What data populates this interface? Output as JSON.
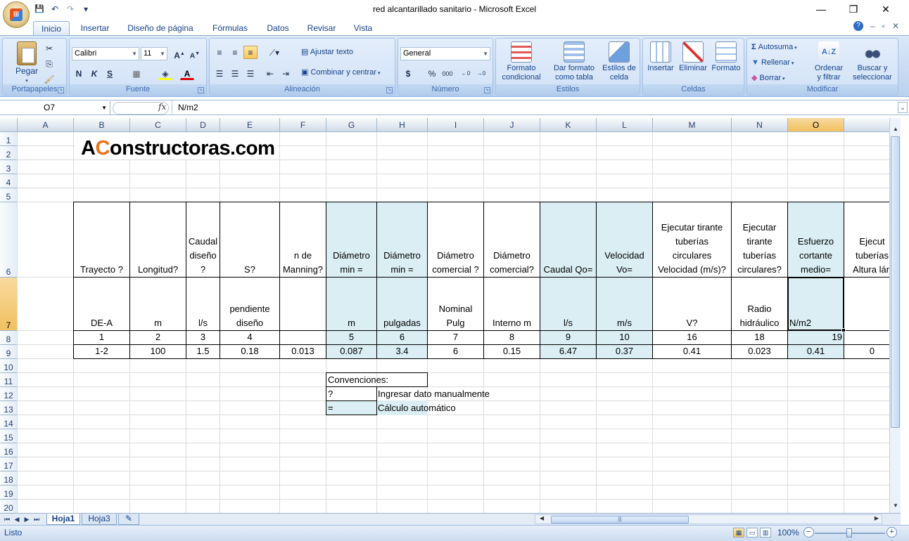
{
  "window": {
    "title": "red alcantarillado sanitario - Microsoft Excel",
    "minimize": "—",
    "restore": "❐",
    "close": "✕"
  },
  "qat": {
    "save": "💾",
    "undo": "↶",
    "redo": "↷",
    "customize": "▾"
  },
  "tabs": [
    "Inicio",
    "Insertar",
    "Diseño de página",
    "Fórmulas",
    "Datos",
    "Revisar",
    "Vista"
  ],
  "ribbon": {
    "portapapeles": {
      "label": "Portapapeles",
      "pegar": "Pegar"
    },
    "fuente": {
      "label": "Fuente",
      "font": "Calibri",
      "size": "11",
      "bold": "N",
      "italic": "K",
      "underline": "S"
    },
    "alineacion": {
      "label": "Alineación",
      "ajustar": "Ajustar texto",
      "combinar": "Combinar y centrar"
    },
    "numero": {
      "label": "Número",
      "format": "General",
      "currency": "$",
      "percent": "%",
      "thousands": "000"
    },
    "estilos": {
      "label": "Estilos",
      "formato_condicional": [
        "Formato",
        "condicional"
      ],
      "dar_formato": [
        "Dar formato",
        "como tabla"
      ],
      "estilos_celda": [
        "Estilos de",
        "celda"
      ]
    },
    "celdas": {
      "label": "Celdas",
      "insertar": "Insertar",
      "eliminar": "Eliminar",
      "formato": "Formato"
    },
    "modificar": {
      "label": "Modificar",
      "autosuma": "Autosuma",
      "rellenar": "Rellenar",
      "borrar": "Borrar",
      "ordenar": [
        "Ordenar",
        "y filtrar"
      ],
      "buscar": [
        "Buscar y",
        "seleccionar"
      ]
    }
  },
  "formula_bar": {
    "name_box": "O7",
    "fx": "fx",
    "formula": "N/m2"
  },
  "columns": [
    "A",
    "B",
    "C",
    "D",
    "E",
    "F",
    "G",
    "H",
    "I",
    "J",
    "K",
    "L",
    "M",
    "N",
    "O"
  ],
  "rows": [
    "1",
    "2",
    "3",
    "4",
    "5",
    "6",
    "7",
    "8",
    "9",
    "10",
    "11",
    "12",
    "13",
    "14",
    "15",
    "16",
    "17",
    "18",
    "19",
    "20"
  ],
  "logo": {
    "pre": "A",
    "c": "C",
    "rest": "onstructoras",
    "domain": ".com"
  },
  "header_row6": [
    [
      "Trayecto ?"
    ],
    [
      "Longitud?"
    ],
    [
      "Caudal",
      "diseño",
      "?"
    ],
    [
      "S?"
    ],
    [
      "n de",
      "Manning?"
    ],
    [
      "Diámetro",
      "min ="
    ],
    [
      "Diámetro",
      "min ="
    ],
    [
      "Diámetro",
      "comercial ?"
    ],
    [
      "Diámetro",
      "comercial?"
    ],
    [
      "Caudal Qo="
    ],
    [
      "Velocidad",
      "Vo="
    ],
    [
      "Ejecutar tirante",
      "tuberías",
      "circulares",
      "Velocidad (m/s)?"
    ],
    [
      "Ejecutar",
      "tirante",
      "tuberías",
      "circulares?"
    ],
    [
      "Esfuerzo",
      "cortante",
      "medio="
    ],
    [
      "Ejecut",
      "tuberías",
      "Altura lán"
    ]
  ],
  "header_row7": [
    [
      "DE-A"
    ],
    [
      "m"
    ],
    [
      "l/s"
    ],
    [
      "pendiente",
      "diseño"
    ],
    [
      ""
    ],
    [
      "m"
    ],
    [
      "pulgadas"
    ],
    [
      "Nominal",
      "Pulg"
    ],
    [
      "Interno m"
    ],
    [
      "l/s"
    ],
    [
      "m/s"
    ],
    [
      "V?"
    ],
    [
      "Radio",
      "hidráulico"
    ],
    [
      "N/m2"
    ],
    [
      ""
    ]
  ],
  "row8": [
    "1",
    "2",
    "3",
    "4",
    "",
    "5",
    "6",
    "7",
    "8",
    "9",
    "10",
    "16",
    "18",
    "19",
    ""
  ],
  "row9": [
    "1-2",
    "100",
    "1.5",
    "0.18",
    "0.013",
    "0.087",
    "3.4",
    "6",
    "0.15",
    "6.47",
    "0.37",
    "0.41",
    "0.023",
    "0.41",
    "0"
  ],
  "conventions": {
    "title": "Convenciones:",
    "manual_symbol": "?",
    "manual_text": "Ingresar dato manualmente",
    "auto_symbol": "=",
    "auto_text": "Cálculo automático"
  },
  "sheets": [
    "Hoja1",
    "Hoja3"
  ],
  "status": {
    "text": "Listo",
    "zoom": "100%"
  },
  "colors": {
    "calc_fill": "#daeef3",
    "selection_header": "#f1c15f",
    "ribbon_bg": "#c4d8f1"
  }
}
